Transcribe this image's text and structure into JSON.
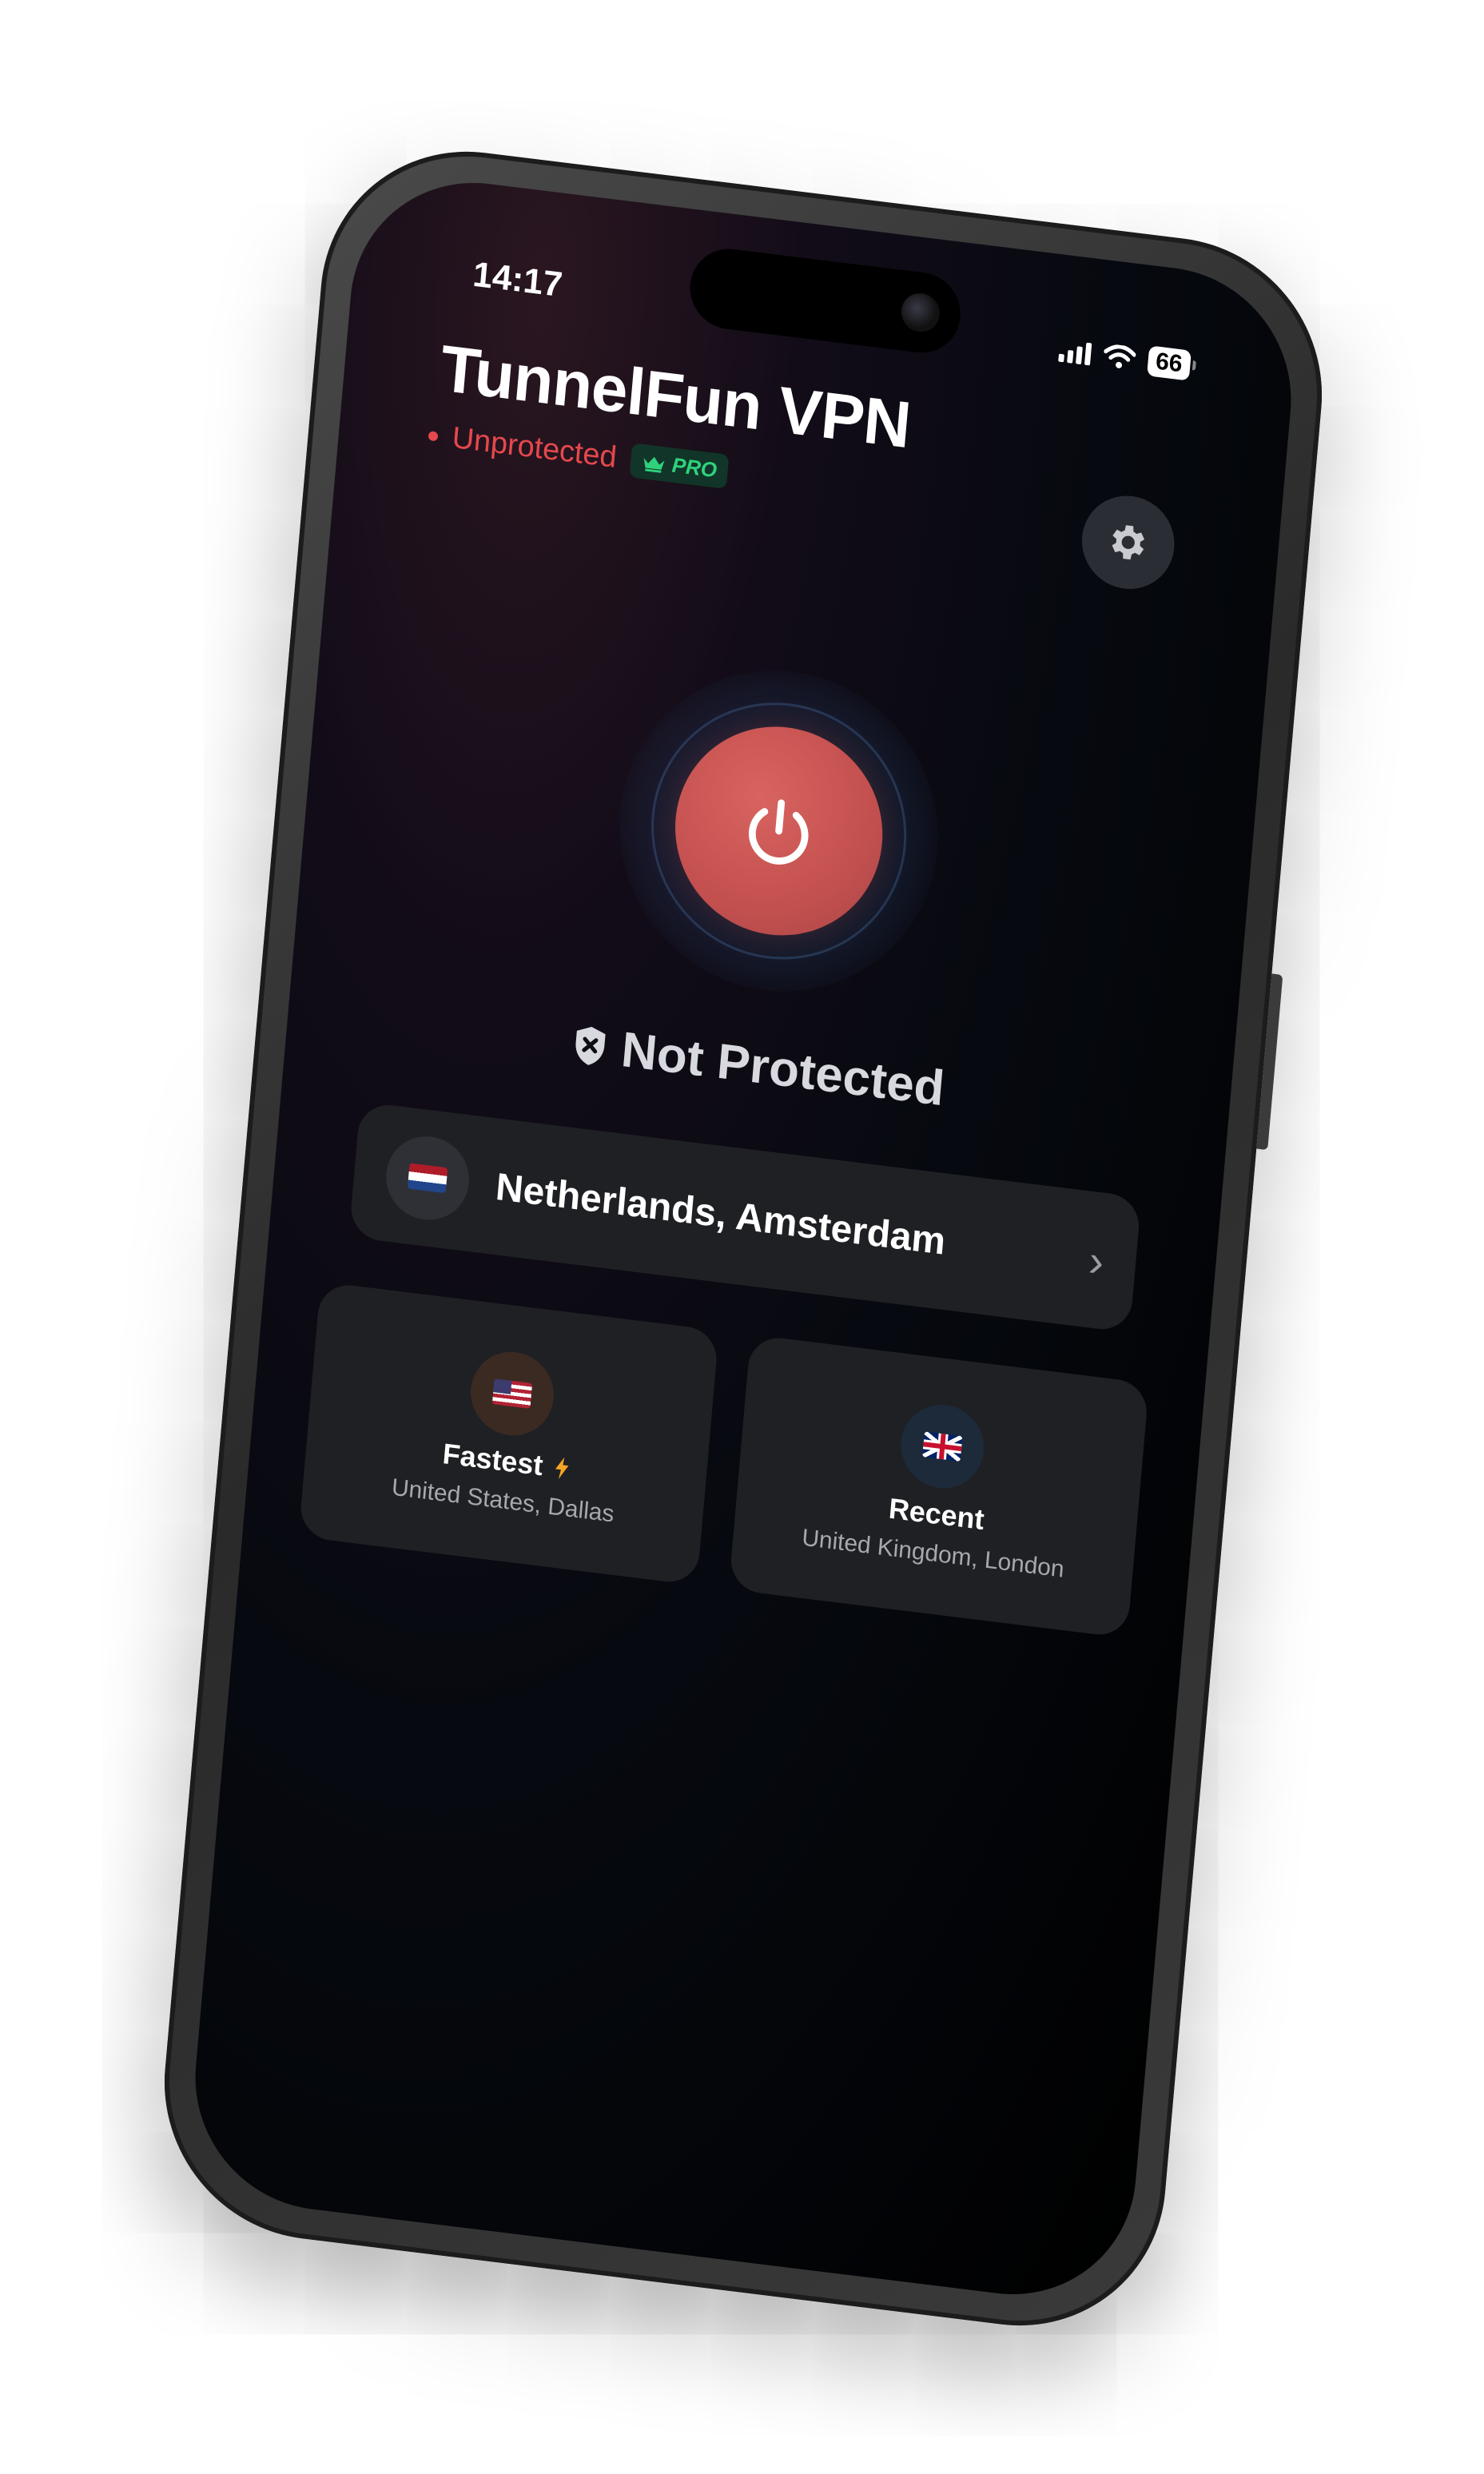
{
  "status_bar": {
    "time": "14:17",
    "battery": "66"
  },
  "header": {
    "title": "TunnelFun VPN",
    "status": "Unprotected",
    "badge": "PRO"
  },
  "connection": {
    "state_label": "Not Protected"
  },
  "selected_location": {
    "name": "Netherlands, Amsterdam",
    "flag": "netherlands-flag"
  },
  "quick_picks": [
    {
      "title": "Fastest",
      "subtitle": "United States, Dallas",
      "flag": "united-states-flag",
      "icon": "lightning-icon"
    },
    {
      "title": "Recent",
      "subtitle": "United Kingdom, London",
      "flag": "united-kingdom-flag"
    }
  ],
  "colors": {
    "danger": "#e5484d",
    "power_button": "#c3504f",
    "pro_green": "#2fd17c",
    "card_bg": "#1f2024",
    "lightning": "#f5a524"
  }
}
